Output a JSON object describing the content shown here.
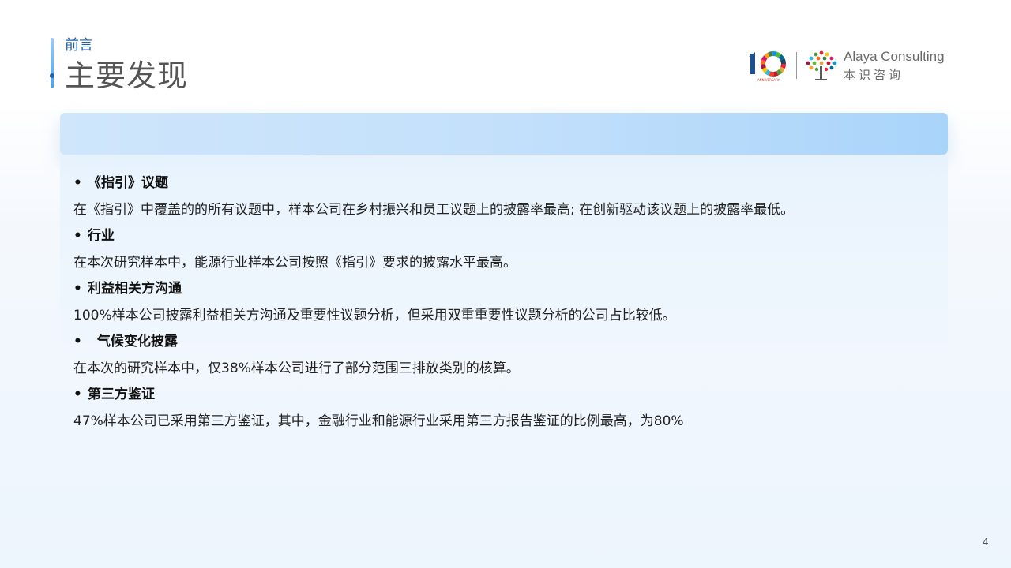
{
  "header": {
    "subtitle": "前言",
    "title": "主要发现"
  },
  "logo": {
    "ten_text": "10",
    "anniversary_text": "ANNIVERSARY",
    "company_en": "Alaya Consulting",
    "company_cn": "本识咨询"
  },
  "findings": [
    {
      "bullet": "•",
      "heading": "《指引》议题",
      "body": "在《指引》中覆盖的的所有议题中，样本公司在乡村振兴和员工议题上的披露率最高; 在创新驱动该议题上的披露率最低。"
    },
    {
      "bullet": "•",
      "heading": "行业",
      "body": "在本次研究样本中，能源行业样本公司按照《指引》要求的披露水平最高。"
    },
    {
      "bullet": "•",
      "heading": "利益相关方沟通",
      "body": "100%样本公司披露利益相关方沟通及重要性议题分析，但采用双重重要性议题分析的公司占比较低。"
    },
    {
      "bullet": "•",
      "heading": "  气候变化披露",
      "body": "在本次的研究样本中，仅38%样本公司进行了部分范围三排放类别的核算。"
    },
    {
      "bullet": "•",
      "heading": "第三方鉴证",
      "body": "47%样本公司已采用第三方鉴证，其中，金融行业和能源行业采用第三方报告鉴证的比例最高，为80%"
    }
  ],
  "page_number": "4",
  "colors": {
    "accent_blue": "#1f5fa8",
    "banner_blue": "#c3e0fb",
    "title_gray": "#555555"
  }
}
